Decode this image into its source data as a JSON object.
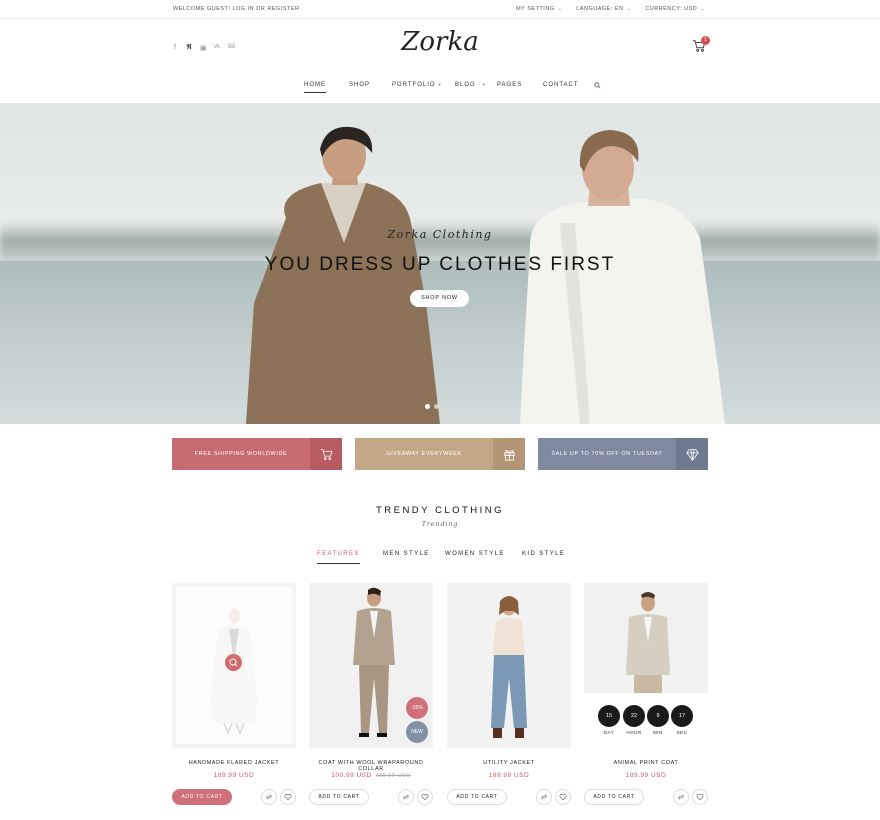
{
  "topbar": {
    "welcome": "WELCOME GUEST! LOG IN OR REGISTER",
    "my_setting": "MY SETTING",
    "language": "LANGUAGE: EN",
    "currency": "CURRENCY: USD"
  },
  "header": {
    "logo": "Zorka",
    "socials": [
      "facebook-icon",
      "twitter-icon",
      "instagram-icon",
      "vk-icon",
      "behance-icon"
    ],
    "cart_count": "1"
  },
  "nav": {
    "items": [
      {
        "label": "HOME"
      },
      {
        "label": "SHOP"
      },
      {
        "label": "PORTFOLIO"
      },
      {
        "label": "BLOG"
      },
      {
        "label": "PAGES"
      },
      {
        "label": "CONTACT"
      }
    ]
  },
  "hero": {
    "subtitle": "Zorka Clothing",
    "title": "YOU DRESS UP CLOTHES FIRST",
    "button": "SHOP NOW"
  },
  "promos": [
    {
      "label": "FREE SHIPPING WORLDWIDE",
      "icon": "cart-icon",
      "color": "#c86c73"
    },
    {
      "label": "GIVEAWAY EVERYWEEK",
      "icon": "gift-icon",
      "color": "#c3a888"
    },
    {
      "label": "SALE UP TO 70% OFF ON TUESDAY",
      "icon": "diamond-icon",
      "color": "#7f8aa1"
    }
  ],
  "section": {
    "title": "TRENDY CLOTHING",
    "subtitle": "Trending"
  },
  "tabs": [
    {
      "label": "FEATURES"
    },
    {
      "label": "MEN STYLE"
    },
    {
      "label": "WOMEN STYLE"
    },
    {
      "label": "KID STYLE"
    }
  ],
  "products": [
    {
      "name": "HANDMADE FLARED JACKET",
      "price": "189.99 USD",
      "old_price": "",
      "button": "ADD TO CART"
    },
    {
      "name": "COAT WITH WOOL WRAPAROUND COLLAR",
      "price": "100.99 USD",
      "old_price": "189.99 USD",
      "button": "ADD TO CART",
      "badges": [
        "-25%",
        "NEW"
      ]
    },
    {
      "name": "UTILITY JACKET",
      "price": "189.99 USD",
      "old_price": "",
      "button": "ADD TO CART"
    },
    {
      "name": "ANIMAL PRINT COAT",
      "price": "189.99 USD",
      "old_price": "",
      "button": "ADD TO CART",
      "countdown": [
        {
          "value": "15",
          "label": "DAY"
        },
        {
          "value": "22",
          "label": "HOUR"
        },
        {
          "value": "9",
          "label": "MIN"
        },
        {
          "value": "17",
          "label": "SEC"
        }
      ]
    }
  ]
}
